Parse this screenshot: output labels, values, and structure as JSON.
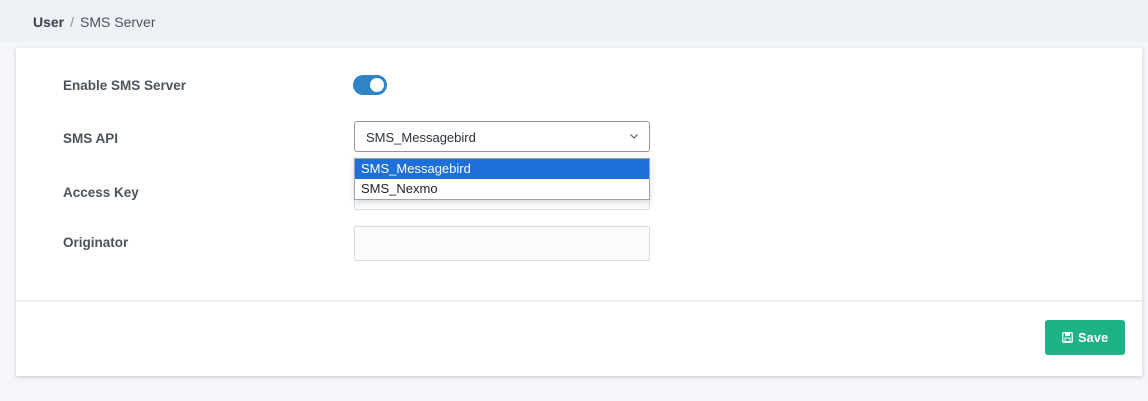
{
  "breadcrumb": {
    "parent": "User",
    "separator": "/",
    "current": "SMS Server"
  },
  "form": {
    "enable_label": "Enable SMS Server",
    "enable_on": true,
    "api_label": "SMS API",
    "api_value": "SMS_Messagebird",
    "api_options": [
      "SMS_Messagebird",
      "SMS_Nexmo"
    ],
    "access_key_label": "Access Key",
    "access_key_value": "",
    "originator_label": "Originator",
    "originator_value": ""
  },
  "footer": {
    "save_label": "Save"
  },
  "colors": {
    "accent": "#2f84c6",
    "save": "#1eb387",
    "selected_option": "#1e6fd9"
  },
  "icons": {
    "save": "floppy-disk-icon",
    "dropdown": "chevron-down-icon"
  }
}
